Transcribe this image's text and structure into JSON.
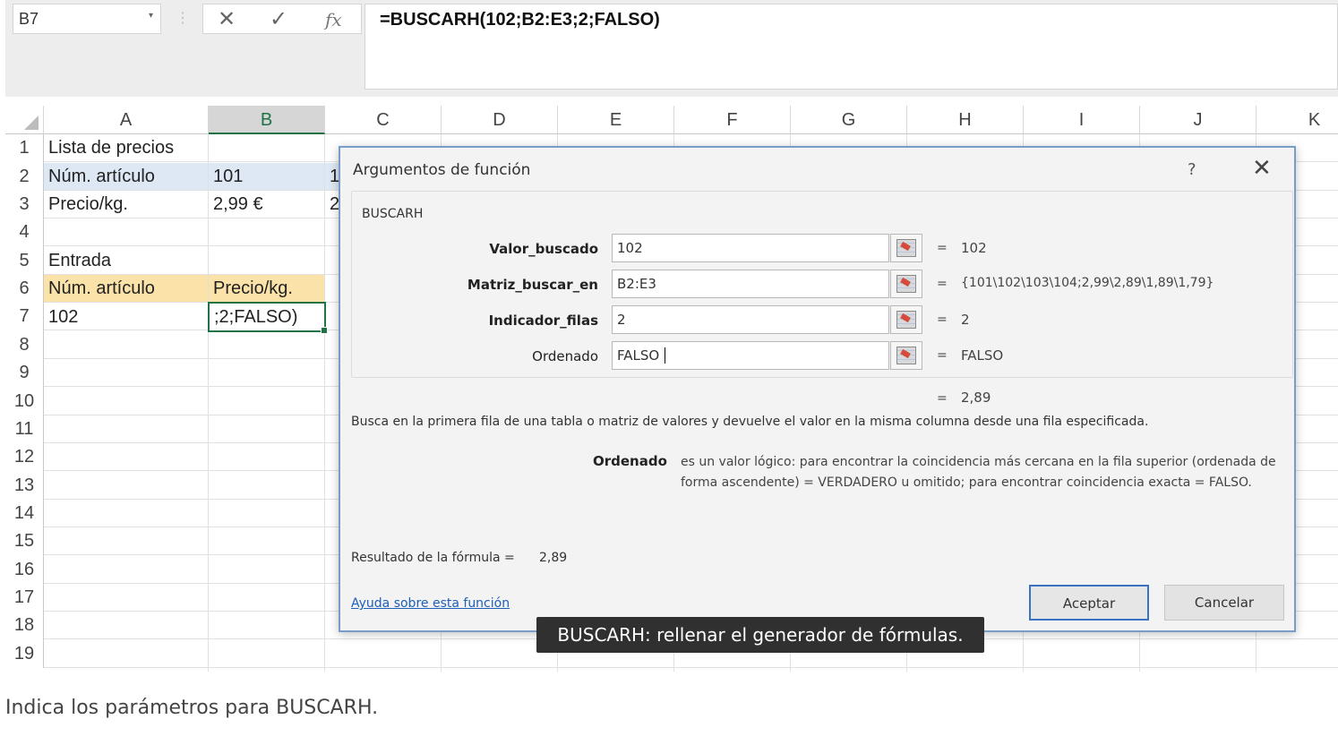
{
  "formula_bar": {
    "name_box": "B7",
    "formula": "=BUSCARH(102;B2:E3;2;FALSO)"
  },
  "icons": {
    "cancel": "close-icon",
    "enter": "checkmark-icon",
    "function": "fx-icon"
  },
  "columns": [
    "A",
    "B",
    "C",
    "D",
    "E",
    "F",
    "G",
    "H",
    "I",
    "J",
    "K"
  ],
  "rows": [
    "1",
    "2",
    "3",
    "4",
    "5",
    "6",
    "7",
    "8",
    "9",
    "10",
    "11",
    "12",
    "13",
    "14",
    "15",
    "16",
    "17",
    "18",
    "19"
  ],
  "cells": {
    "A1": "Lista de precios",
    "A2": "Núm. artículo",
    "B2": "101",
    "C2": "1",
    "A3": "Precio/kg.",
    "B3": "2,99 €",
    "C3": "2",
    "A5": "Entrada",
    "A6": "Núm. artículo",
    "B6": "Precio/kg.",
    "A7": "102",
    "B7": ";2;FALSO)"
  },
  "dialog": {
    "title": "Argumentos de función",
    "help": "?",
    "close": "✕",
    "function_name": "BUSCARH",
    "args": [
      {
        "label": "Valor_buscado",
        "value": "102",
        "eq": "=",
        "result": "102"
      },
      {
        "label": "Matriz_buscar_en",
        "value": "B2:E3",
        "eq": "=",
        "result": "{101\\102\\103\\104;2,99\\2,89\\1,89\\1,79}"
      },
      {
        "label": "Indicador_filas",
        "value": "2",
        "eq": "=",
        "result": "2"
      },
      {
        "label": "Ordenado",
        "value": "FALSO",
        "eq": "=",
        "result": "FALSO"
      }
    ],
    "eq": "=",
    "overall_result": "2,89",
    "description": "Busca en la primera fila de una tabla o matriz de valores y devuelve el valor en la misma columna desde una fila especificada.",
    "param_name": "Ordenado",
    "param_description": "es un valor lógico: para encontrar la coincidencia más cercana en la fila superior (ordenada de forma ascendente) = VERDADERO u omitido; para encontrar coincidencia exacta = FALSO.",
    "result_label": "Resultado de la fórmula =",
    "result_value": "2,89",
    "help_link": "Ayuda sobre esta función",
    "ok_button": "Aceptar",
    "cancel_button": "Cancelar"
  },
  "tooltip": "BUSCARH: rellenar el generador de fórmulas.",
  "caption": "Indica los parámetros para BUSCARH."
}
